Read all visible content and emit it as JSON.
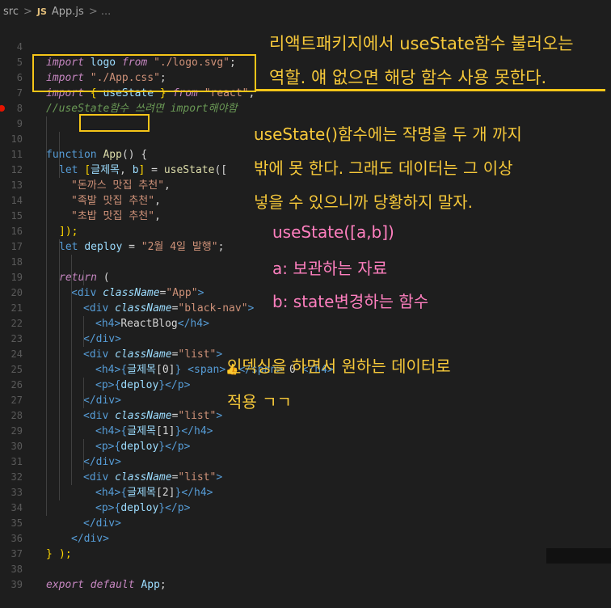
{
  "breadcrumb": {
    "folder": "src",
    "separator": ">",
    "file_icon": "JS",
    "file": "App.js",
    "tail": "> ..."
  },
  "code": {
    "l4": {
      "n": "4",
      "kw": "import",
      "a": "logo",
      "from": "from",
      "str": "\"./logo.svg\"",
      "end": ";"
    },
    "l5": {
      "n": "5",
      "kw": "import",
      "str": "\"./App.css\"",
      "end": ";"
    },
    "l6": {
      "n": "6",
      "kw": "import",
      "ob": "{",
      "a": "useState",
      "cb": "}",
      "from": "from",
      "str": "\"react\"",
      "end": ";"
    },
    "l7": {
      "n": "7",
      "cmt": "//useState함수 쓰려면 import해야함"
    },
    "l8": {
      "n": "8"
    },
    "l9": {
      "n": "9",
      "kw": "function",
      "fn": "App",
      "rest": "() {"
    },
    "l10": {
      "n": "10",
      "kw": "let",
      "lb": "[",
      "a": "글제목",
      "comma": ", ",
      "b": "b",
      "rb": "]",
      "eq": " = ",
      "fn": "useState",
      "rest": "(["
    },
    "l11": {
      "n": "11",
      "str": "\"돈까스 맛집 추천\"",
      "end": ","
    },
    "l12": {
      "n": "12",
      "str": "\"족발 맛집 추천\"",
      "end": ","
    },
    "l13": {
      "n": "13",
      "str": "\"초밥 맛집 추천\"",
      "end": ","
    },
    "l14": {
      "n": "14",
      "rest": "]);"
    },
    "l15": {
      "n": "15",
      "kw": "let",
      "a": "deploy",
      "eq": " = ",
      "str": "\"2월 4일 발행\"",
      "end": ";"
    },
    "l16": {
      "n": "16"
    },
    "l17": {
      "n": "17",
      "kw": "return",
      "rest": " ("
    },
    "l18": {
      "n": "18",
      "open": "<",
      "tag": "div",
      "attr": "className",
      "eq": "=",
      "str": "\"App\"",
      "close": ">"
    },
    "l19": {
      "n": "19",
      "open": "<",
      "tag": "div",
      "attr": "className",
      "eq": "=",
      "str": "\"black-nav\"",
      "close": ">"
    },
    "l20": {
      "n": "20",
      "open": "<",
      "tag": "h4",
      "close": ">",
      "text": "ReactBlog",
      "eopen": "</",
      "etag": "h4",
      "eclose": ">"
    },
    "l21": {
      "n": "21",
      "eopen": "</",
      "etag": "div",
      "eclose": ">"
    },
    "l22": {
      "n": "22",
      "open": "<",
      "tag": "div",
      "attr": "className",
      "eq": "=",
      "str": "\"list\"",
      "close": ">"
    },
    "l23": {
      "n": "23",
      "open": "<",
      "tag": "h4",
      "close": ">",
      "lb": "{",
      "a": "글제목",
      "idx": "[0]",
      "rb": "}",
      "sopen": " <",
      "stag": "span",
      "sclose": ">",
      "emoji": "👍",
      "seopen": "</",
      "setag": "span",
      "seclose": ">",
      "count": " 0 ",
      "eopen": "</",
      "etag": "h4",
      "eclose": ">"
    },
    "l24": {
      "n": "24",
      "open": "<",
      "tag": "p",
      "close": ">",
      "lb": "{",
      "a": "deploy",
      "rb": "}",
      "eopen": "</",
      "etag": "p",
      "eclose": ">"
    },
    "l25": {
      "n": "25",
      "eopen": "</",
      "etag": "div",
      "eclose": ">"
    },
    "l26": {
      "n": "26",
      "open": "<",
      "tag": "div",
      "attr": "className",
      "eq": "=",
      "str": "\"list\"",
      "close": ">"
    },
    "l27": {
      "n": "27",
      "open": "<",
      "tag": "h4",
      "close": ">",
      "lb": "{",
      "a": "글제목",
      "idx": "[1]",
      "rb": "}",
      "eopen": "</",
      "etag": "h4",
      "eclose": ">"
    },
    "l28": {
      "n": "28",
      "open": "<",
      "tag": "p",
      "close": ">",
      "lb": "{",
      "a": "deploy",
      "rb": "}",
      "eopen": "</",
      "etag": "p",
      "eclose": ">"
    },
    "l29": {
      "n": "29",
      "eopen": "</",
      "etag": "div",
      "eclose": ">"
    },
    "l30": {
      "n": "30",
      "open": "<",
      "tag": "div",
      "attr": "className",
      "eq": "=",
      "str": "\"list\"",
      "close": ">"
    },
    "l31": {
      "n": "31",
      "open": "<",
      "tag": "h4",
      "close": ">",
      "lb": "{",
      "a": "글제목",
      "idx": "[2]",
      "rb": "}",
      "eopen": "</",
      "etag": "h4",
      "eclose": ">"
    },
    "l32": {
      "n": "32",
      "open": "<",
      "tag": "p",
      "close": ">",
      "lb": "{",
      "a": "deploy",
      "rb": "}",
      "eopen": "</",
      "etag": "p",
      "eclose": ">"
    },
    "l33": {
      "n": "33",
      "eopen": "</",
      "etag": "div",
      "eclose": ">"
    },
    "l34": {
      "n": "34",
      "eopen": "</",
      "etag": "div",
      "eclose": ">"
    },
    "l35": {
      "n": "35",
      "rest": ");"
    },
    "l36": {
      "n": "36",
      "rest": "}"
    },
    "l37": {
      "n": "37"
    },
    "l38": {
      "n": "38",
      "kw": "export",
      "kw2": "default",
      "a": "App",
      "end": ";"
    },
    "l39": {
      "n": "39"
    }
  },
  "annotations": {
    "import_note_1": "리액트패키지에서 useState함수 불러오는",
    "import_note_2": "역할. 얘 없으면 해당 함수 사용 못한다.",
    "state_note_1": "useState()함수에는 작명을 두 개 까지",
    "state_note_2": "밖에 못 한다. 그래도 데이터는 그 이상",
    "state_note_3": "넣을 수 있으니까 당황하지 말자.",
    "syntax": "useState([a,b])",
    "a_desc": "a: 보관하는 자료",
    "b_desc": "b: state변경하는 함수",
    "index_note_1": "인덱싱을 하면서 원하는 데이터로",
    "index_note_2": "적용 ㄱㄱ"
  },
  "colors": {
    "highlight_box": "#f5c518",
    "annotation_yellow": "#f7c93a",
    "annotation_pink": "#ff7fbf",
    "background": "#1e1e1e"
  }
}
